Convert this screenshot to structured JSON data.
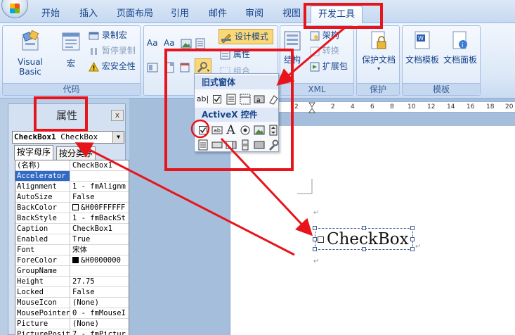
{
  "tabs": [
    {
      "label": "开始"
    },
    {
      "label": "插入"
    },
    {
      "label": "页面布局"
    },
    {
      "label": "引用"
    },
    {
      "label": "邮件"
    },
    {
      "label": "审阅"
    },
    {
      "label": "视图"
    },
    {
      "label": "开发工具"
    }
  ],
  "ribbon": {
    "code": {
      "title": "代码",
      "visual_basic": "Visual Basic",
      "macro": "宏",
      "record_macro": "录制宏",
      "pause_recording": "暂停录制",
      "macro_security": "宏安全性"
    },
    "controls": {
      "aa1": "Aa",
      "aa2": "Aa",
      "design_mode": "设计模式",
      "properties": "属性",
      "group": "组合"
    },
    "xml": {
      "title": "XML",
      "structure": "结构",
      "schema": "架构",
      "transform": "转换",
      "expansion_pack": "扩展包"
    },
    "protect": {
      "title": "保护",
      "protect_document": "保护文档"
    },
    "templates": {
      "title": "模板",
      "document_template": "文档模板",
      "document_panel": "文档面板"
    }
  },
  "gallery": {
    "legacy_title": "旧式窗体",
    "activex_title": "ActiveX 控件",
    "legacy_text_field": "ab|"
  },
  "properties_panel": {
    "title": "属性",
    "close": "x",
    "combo_name": "CheckBox1",
    "combo_type": "CheckBox",
    "tab_alphabetic": "按字母序",
    "tab_categorized": "按分类序",
    "rows": [
      {
        "name": "(名称)",
        "value": "CheckBox1"
      },
      {
        "name": "Accelerator",
        "value": ""
      },
      {
        "name": "Alignment",
        "value": "1 - fmAlignm"
      },
      {
        "name": "AutoSize",
        "value": "False"
      },
      {
        "name": "BackColor",
        "value": "&H00FFFFFF"
      },
      {
        "name": "BackStyle",
        "value": "1 - fmBackSt"
      },
      {
        "name": "Caption",
        "value": "CheckBox1"
      },
      {
        "name": "Enabled",
        "value": "True"
      },
      {
        "name": "Font",
        "value": "宋体"
      },
      {
        "name": "ForeColor",
        "value": "&H0000000"
      },
      {
        "name": "GroupName",
        "value": ""
      },
      {
        "name": "Height",
        "value": "27.75"
      },
      {
        "name": "Locked",
        "value": "False"
      },
      {
        "name": "MouseIcon",
        "value": "(None)"
      },
      {
        "name": "MousePointer",
        "value": "0 - fmMouseI"
      },
      {
        "name": "Picture",
        "value": "(None)"
      },
      {
        "name": "PicturePosition",
        "value": "7 - fmPictur"
      }
    ]
  },
  "ruler_ticks": [
    "2",
    "2",
    "4",
    "6",
    "8",
    "10",
    "12",
    "14",
    "16",
    "18",
    "20"
  ],
  "document": {
    "checkbox_label": "CheckBox"
  },
  "colors": {
    "annotation_red": "#e8141b",
    "selected_row": "#316ac5",
    "ribbon_text": "#15428b"
  }
}
